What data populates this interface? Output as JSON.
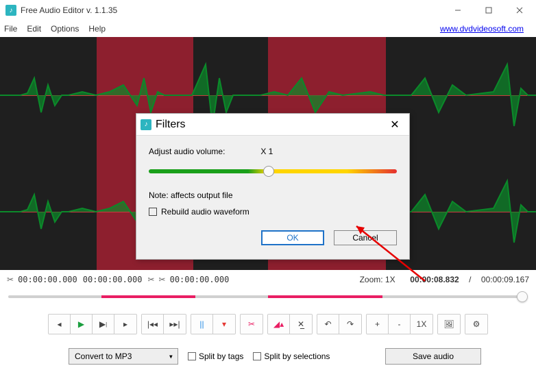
{
  "app": {
    "title": "Free Audio Editor v. 1.1.35"
  },
  "menu": {
    "file": "File",
    "edit": "Edit",
    "options": "Options",
    "help": "Help"
  },
  "link": {
    "url": "www.dvdvideosoft.com"
  },
  "time": {
    "sel_start": "00:00:00.000",
    "sel_end": "00:00:00.000",
    "cut_start": "00:00:00.000",
    "zoom_label": "Zoom: 1X",
    "current": "00:00:08.832",
    "sep": "/",
    "total": "00:00:09.167"
  },
  "toolbar": {
    "btn_1x": "1X",
    "btn_plus": "+",
    "btn_minus": "-"
  },
  "bottom": {
    "convert": "Convert to MP3",
    "split_tags": "Split by tags",
    "split_sel": "Split by selections",
    "save": "Save audio"
  },
  "dialog": {
    "title": "Filters",
    "adjust_label": "Adjust audio volume:",
    "adjust_value": "X 1",
    "note": "Note: affects output file",
    "rebuild": "Rebuild audio waveform",
    "ok": "OK",
    "cancel": "Cancel"
  }
}
